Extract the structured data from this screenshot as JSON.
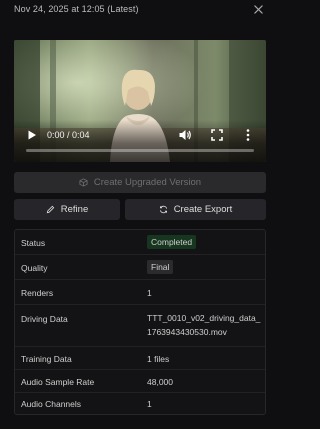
{
  "header": {
    "timestamp": "Nov 24, 2025 at 12:05 (Latest)",
    "close_icon": "close-icon"
  },
  "player": {
    "timecode": "0:00 / 0:04",
    "progress_fraction": 0.0,
    "icons": [
      "play-icon",
      "volume-icon",
      "fullscreen-icon",
      "more-vertical-icon"
    ]
  },
  "actions": {
    "upgrade_label": "Create Upgraded Version",
    "upgrade_icon": "cube-icon",
    "refine_label": "Refine",
    "refine_icon": "pencil-icon",
    "export_label": "Create Export",
    "export_icon": "refresh-icon"
  },
  "details": {
    "status": {
      "key": "Status",
      "value": "Completed",
      "color": "#5fd27b"
    },
    "quality": {
      "key": "Quality",
      "value": "Final"
    },
    "renders": {
      "key": "Renders",
      "value": "1"
    },
    "driving_data": {
      "key": "Driving Data",
      "value_line1": "TTT_0010_v02_driving_data_",
      "value_line2": "1763943430530.mov"
    },
    "training_data": {
      "key": "Training Data",
      "value": "1 files"
    },
    "audio_sample_rate": {
      "key": "Audio Sample Rate",
      "value": "48,000"
    },
    "audio_channels": {
      "key": "Audio Channels",
      "value": "1"
    }
  }
}
